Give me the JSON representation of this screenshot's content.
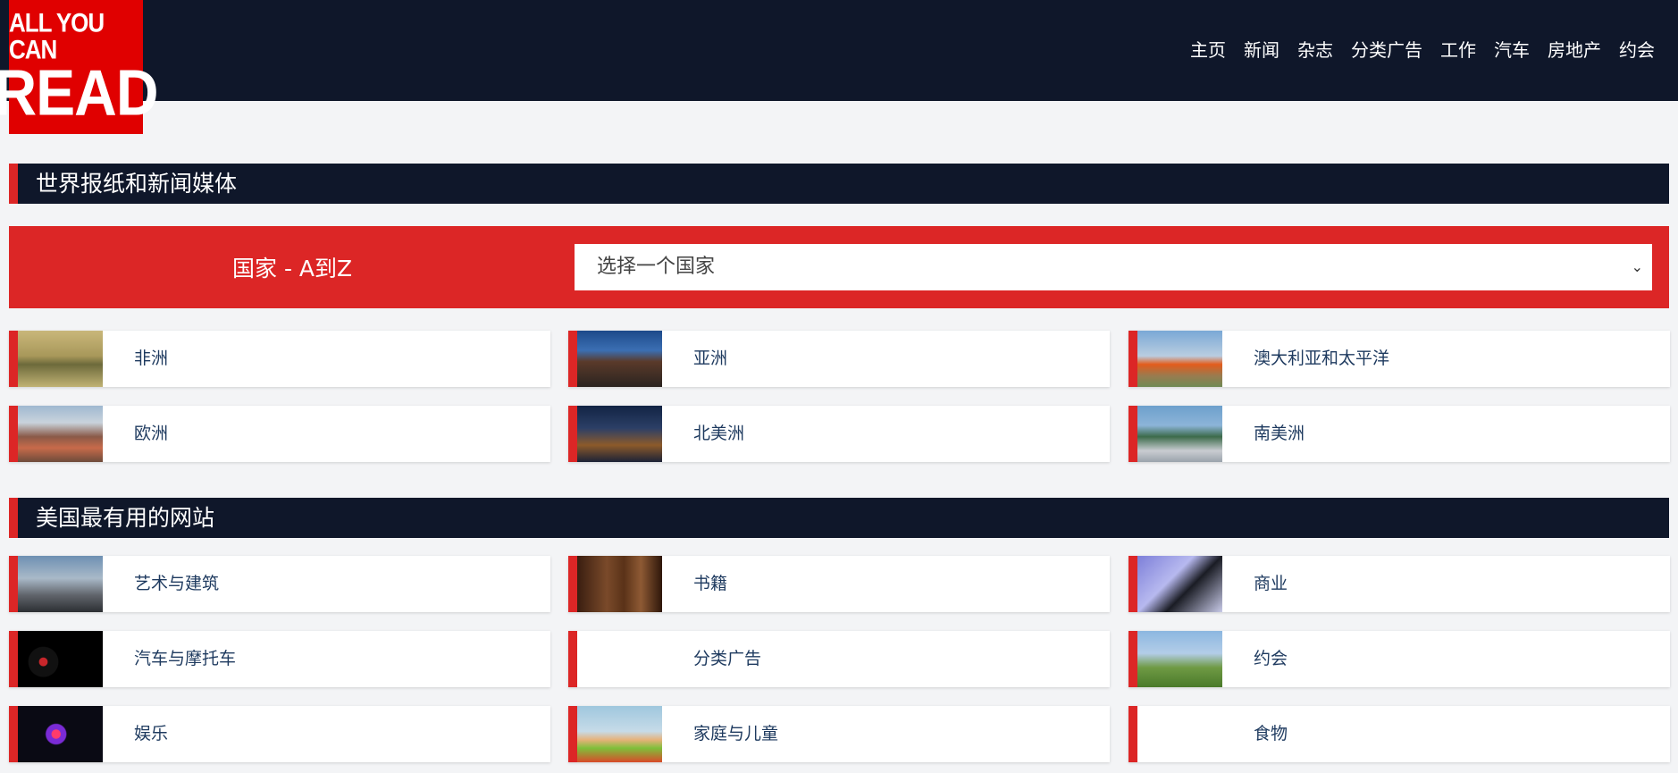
{
  "logo": {
    "line1": "ALL YOU CAN",
    "line2": "READ"
  },
  "nav": [
    "主页",
    "新闻",
    "杂志",
    "分类广告",
    "工作",
    "汽车",
    "房地产",
    "约会"
  ],
  "section1": {
    "title": "世界报纸和新闻媒体",
    "country_label": "国家 - A到Z",
    "country_select_value": "选择一个国家",
    "regions": [
      {
        "label": "非洲",
        "image": "africa"
      },
      {
        "label": "亚洲",
        "image": "asia"
      },
      {
        "label": "澳大利亚和太平洋",
        "image": "australia"
      },
      {
        "label": "欧洲",
        "image": "europe"
      },
      {
        "label": "北美洲",
        "image": "north-america"
      },
      {
        "label": "南美洲",
        "image": "south-america"
      }
    ]
  },
  "section2": {
    "title": "美国最有用的网站",
    "items": [
      {
        "label": "艺术与建筑",
        "image": "art"
      },
      {
        "label": "书籍",
        "image": "books"
      },
      {
        "label": "商业",
        "image": "business"
      },
      {
        "label": "汽车与摩托车",
        "image": "cars"
      },
      {
        "label": "分类广告",
        "image": ""
      },
      {
        "label": "约会",
        "image": "dating"
      },
      {
        "label": "娱乐",
        "image": "entertainment"
      },
      {
        "label": "家庭与儿童",
        "image": "family"
      },
      {
        "label": "食物",
        "image": ""
      }
    ]
  },
  "colors": {
    "header": "#0f172a",
    "accent": "#dc2626",
    "logo": "#e00000",
    "page": "#f3f4f6"
  }
}
